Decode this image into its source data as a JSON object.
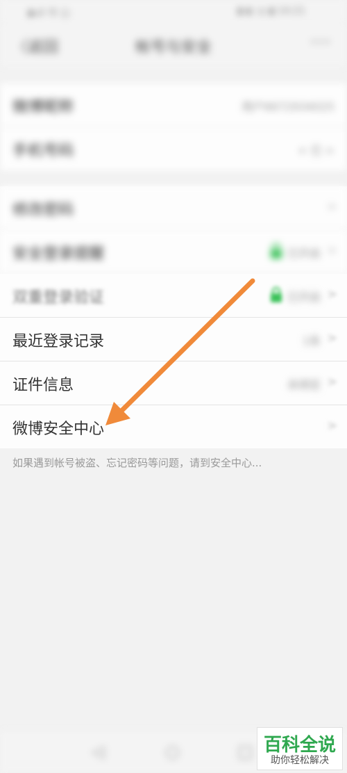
{
  "status_bar": {
    "left": "▮ull 令 ◫",
    "right": "▮ ◐ ◎ ▮ 14:21"
  },
  "nav": {
    "back_label": "〈返回",
    "title": "帐号与安全",
    "more_label": "···"
  },
  "account_group": {
    "rows": [
      {
        "label": "微博昵称",
        "value": "用户6672934025"
      },
      {
        "label": "手机号码",
        "value": "+ 已 >"
      }
    ]
  },
  "security_group": {
    "rows": [
      {
        "label": "修改密码",
        "value": "",
        "chevron": ">"
      },
      {
        "label": "安全登录提醒",
        "value": "已开启",
        "chevron": ">"
      },
      {
        "label": "双重登录验证",
        "value": "已开启",
        "chevron": ">"
      },
      {
        "label": "最近登录记录",
        "value": "1条",
        "chevron": ">"
      },
      {
        "label": "证件信息",
        "value": "未绑定",
        "chevron": ">"
      },
      {
        "label": "微博安全中心",
        "value": "",
        "chevron": ">"
      }
    ]
  },
  "hint": "如果遇到帐号被盗、忘记密码等问题，请到安全中心...",
  "bottom_nav": {
    "back": "◁",
    "home": "○",
    "recent": "□"
  },
  "watermark": {
    "main": "百科全说",
    "sub": "助你轻松解决"
  },
  "colors": {
    "arrow": "#f08a3a",
    "lock": "#3cc25a",
    "watermark_green": "#2fa84f"
  }
}
